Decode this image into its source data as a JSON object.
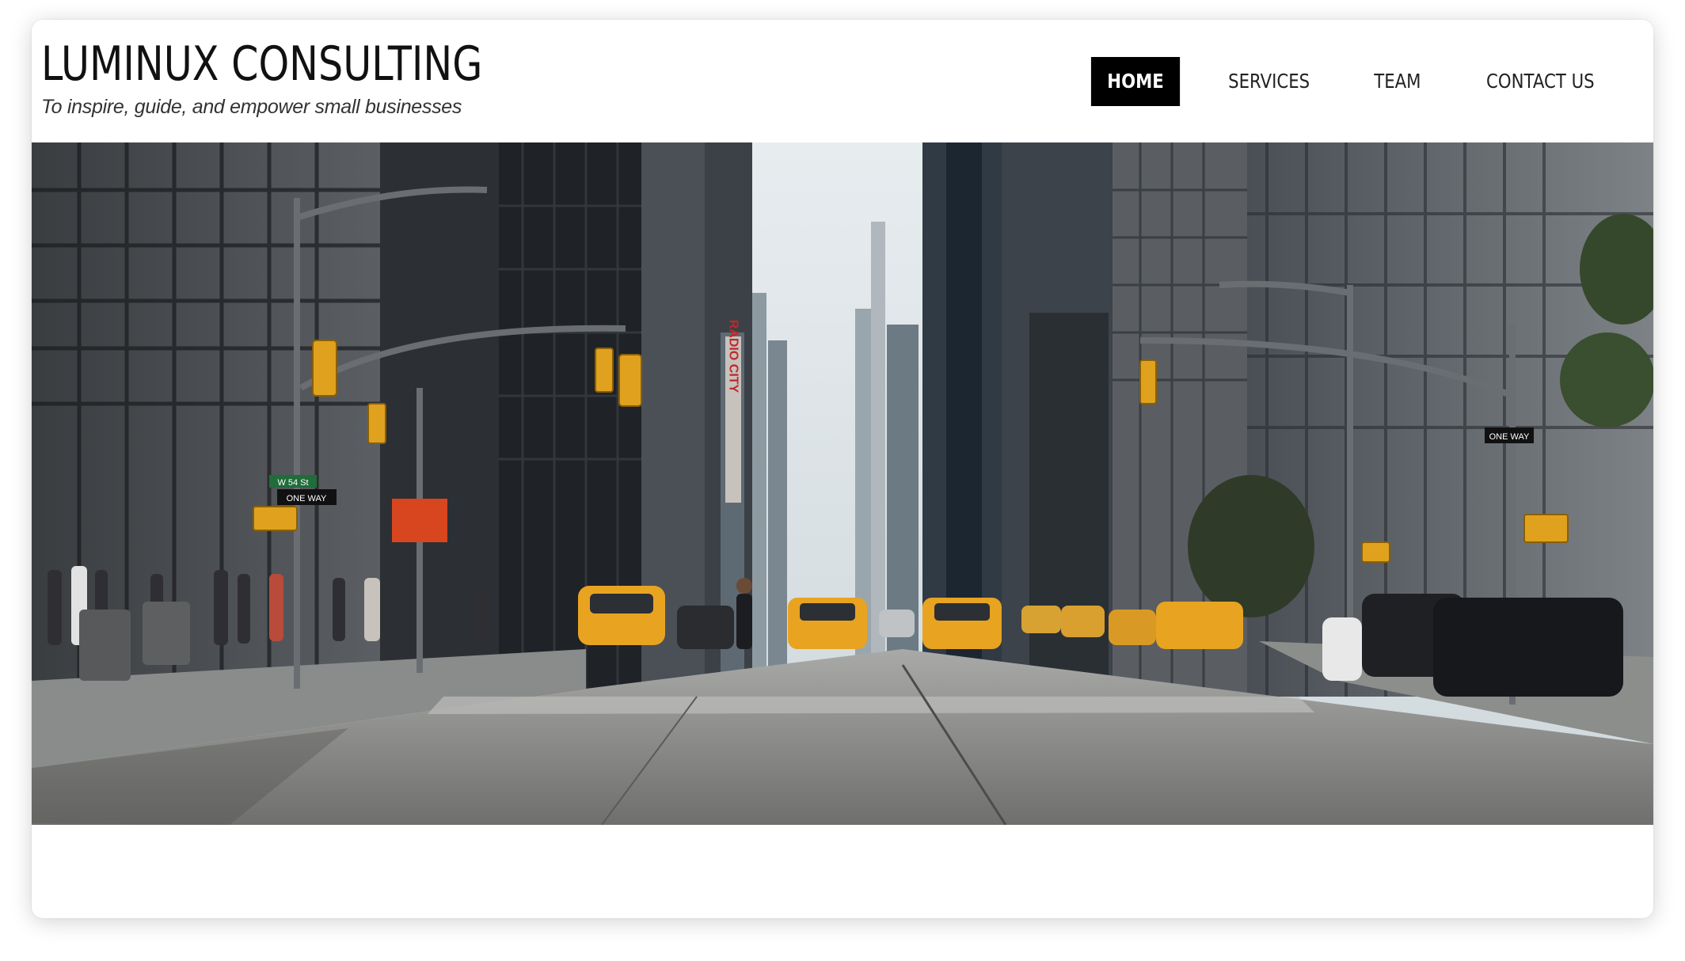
{
  "site": {
    "title": "LUMINUX CONSULTING",
    "tagline": "To inspire, guide, and empower small businesses"
  },
  "nav": {
    "items": [
      {
        "label": "HOME",
        "active": true
      },
      {
        "label": "SERVICES",
        "active": false
      },
      {
        "label": "TEAM",
        "active": false
      },
      {
        "label": "CONTACT US",
        "active": false
      }
    ]
  },
  "hero": {
    "description_icon": "city-street-photo",
    "sign_radio_city": "RADIO CITY",
    "sign_one_way": "ONE WAY",
    "sign_street": "W 54 St"
  },
  "colors": {
    "nav_active_bg": "#000000",
    "nav_active_text": "#ffffff",
    "text": "#111111",
    "taxi": "#e8a321"
  }
}
